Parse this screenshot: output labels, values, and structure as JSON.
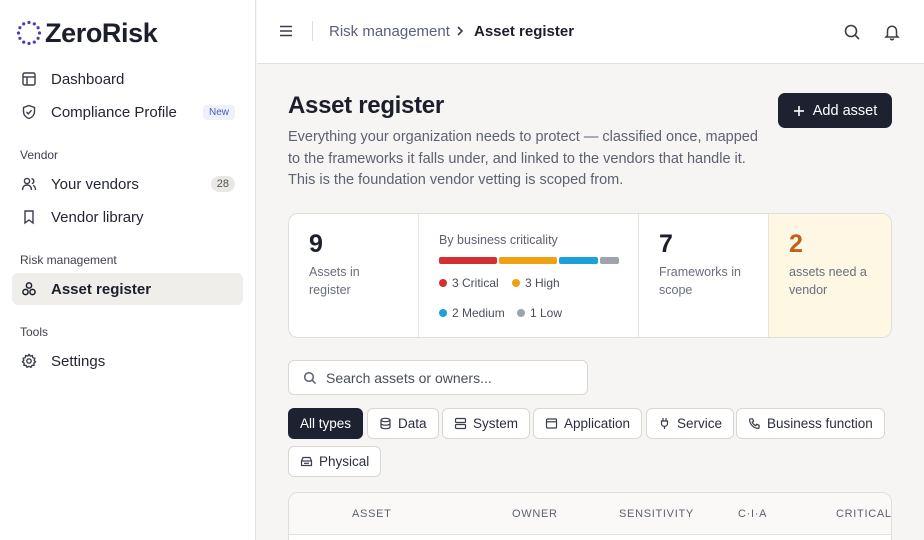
{
  "app": {
    "name": "ZeroRisk"
  },
  "sidebar": {
    "items": [
      {
        "label": "Dashboard",
        "icon": "dashboard-icon"
      },
      {
        "label": "Compliance Profile",
        "icon": "shield-check-icon",
        "badge": "New"
      }
    ],
    "sections": [
      {
        "label": "Vendor",
        "items": [
          {
            "label": "Your vendors",
            "icon": "users-icon",
            "badge": "28"
          },
          {
            "label": "Vendor library",
            "icon": "bookmark-icon"
          }
        ]
      },
      {
        "label": "Risk management",
        "items": [
          {
            "label": "Asset register",
            "icon": "asset-icon",
            "active": true
          }
        ]
      },
      {
        "label": "Tools",
        "items": [
          {
            "label": "Settings",
            "icon": "gear-icon"
          }
        ]
      }
    ]
  },
  "topbar": {
    "breadcrumb": [
      "Risk management",
      "Asset register"
    ]
  },
  "page": {
    "title": "Asset register",
    "description": "Everything your organization needs to protect — classified once, mapped to the frameworks it falls under, and linked to the vendors that handle it. This is the foundation vendor vetting is scoped from.",
    "add_button": "Add asset"
  },
  "stats": {
    "assets": {
      "value": "9",
      "label": "Assets in register"
    },
    "criticality": {
      "title": "By business criticality",
      "levels": [
        {
          "label": "3 Critical",
          "count": 3,
          "color": "#d42f2f"
        },
        {
          "label": "3 High",
          "count": 3,
          "color": "#f1a011"
        },
        {
          "label": "2 Medium",
          "count": 2,
          "color": "#1aa1db"
        },
        {
          "label": "1 Low",
          "count": 1,
          "color": "#9ea3b0"
        }
      ]
    },
    "frameworks": {
      "value": "7",
      "label": "Frameworks in scope"
    },
    "need_vendor": {
      "value": "2",
      "label": "assets need a vendor",
      "color": "#c0621d"
    }
  },
  "search": {
    "placeholder": "Search assets or owners..."
  },
  "filters": [
    "All types",
    "Data",
    "System",
    "Application",
    "Service",
    "Business function",
    "Physical"
  ],
  "table": {
    "columns": [
      "ASSET",
      "OWNER",
      "SENSITIVITY",
      "C·I·A",
      "CRITICALITY"
    ]
  },
  "colors": {
    "accent": "#1d2130",
    "brand": "#4b3fb8"
  }
}
